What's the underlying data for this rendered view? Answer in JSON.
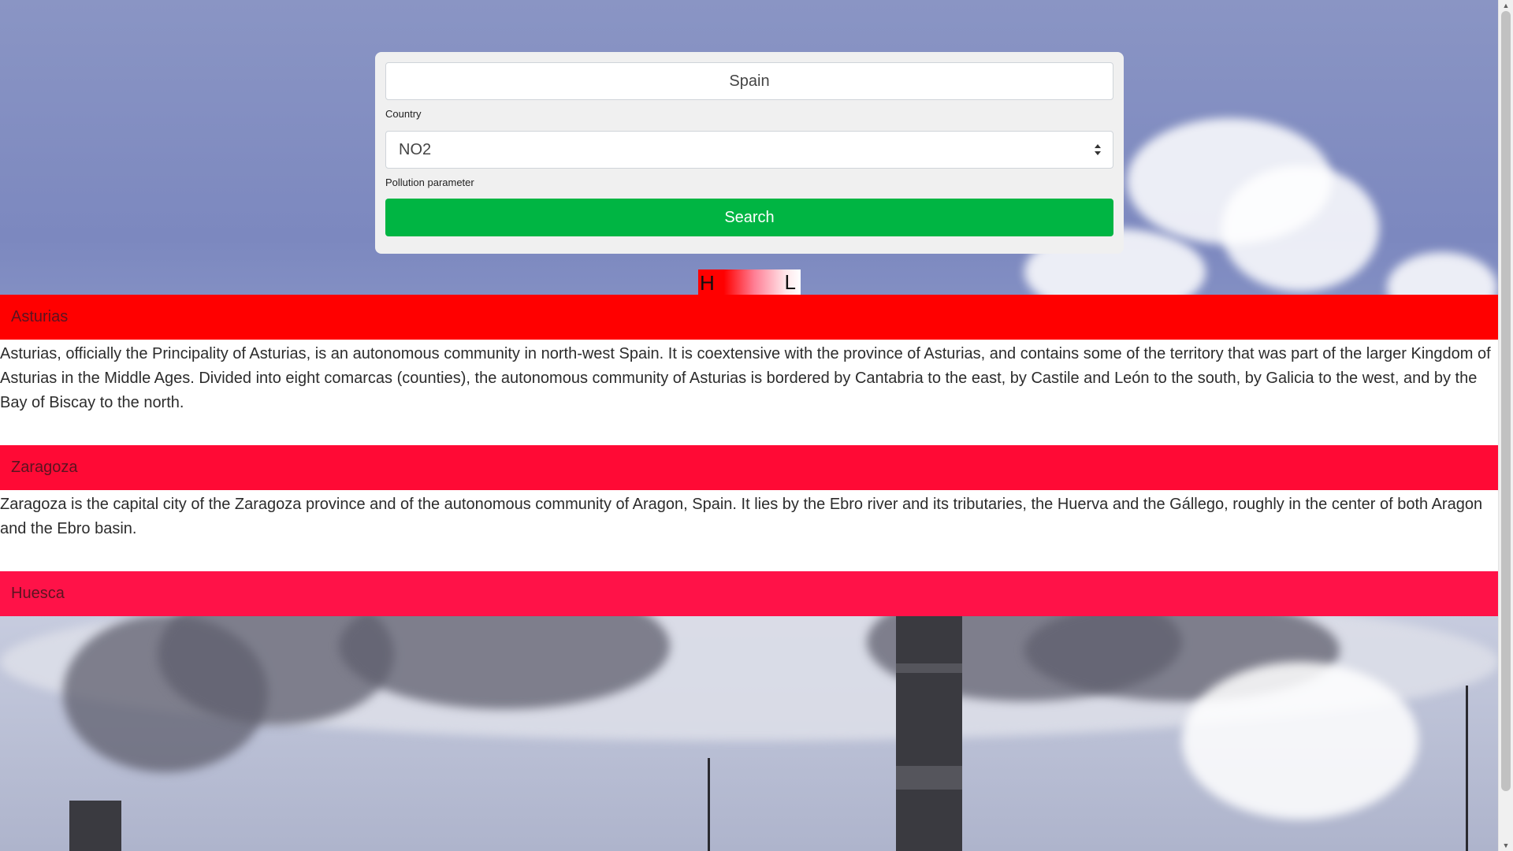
{
  "search": {
    "country_value": "Spain",
    "country_label": "Country",
    "parameter_value": "NO2",
    "parameter_label": "Pollution parameter",
    "search_label": "Search"
  },
  "legend": {
    "high_label": "H",
    "low_label": "L"
  },
  "colors": {
    "search_button": "#00b543",
    "region_1": "#ff0000",
    "region_2": "#ff0a35",
    "region_3": "#ff1248"
  },
  "results": [
    {
      "name": "Asturias",
      "description": "Asturias, officially the Principality of Asturias, is an autonomous community in north-west Spain. It is coextensive with the province of Asturias, and contains some of the territory that was part of the larger Kingdom of Asturias in the Middle Ages. Divided into eight comarcas (counties), the autonomous community of Asturias is bordered by Cantabria to the east, by Castile and León to the south, by Galicia to the west, and by the Bay of Biscay to the north."
    },
    {
      "name": "Zaragoza",
      "description": "Zaragoza is the capital city of the Zaragoza province and of the autonomous community of Aragon, Spain. It lies by the Ebro river and its tributaries, the Huerva and the Gállego, roughly in the center of both Aragon and the Ebro basin."
    },
    {
      "name": "Huesca",
      "description": ""
    }
  ],
  "icons": {
    "select_arrows": "sort-arrows-icon",
    "scroll_up": "triangle-up-icon",
    "scroll_down": "triangle-down-icon"
  }
}
